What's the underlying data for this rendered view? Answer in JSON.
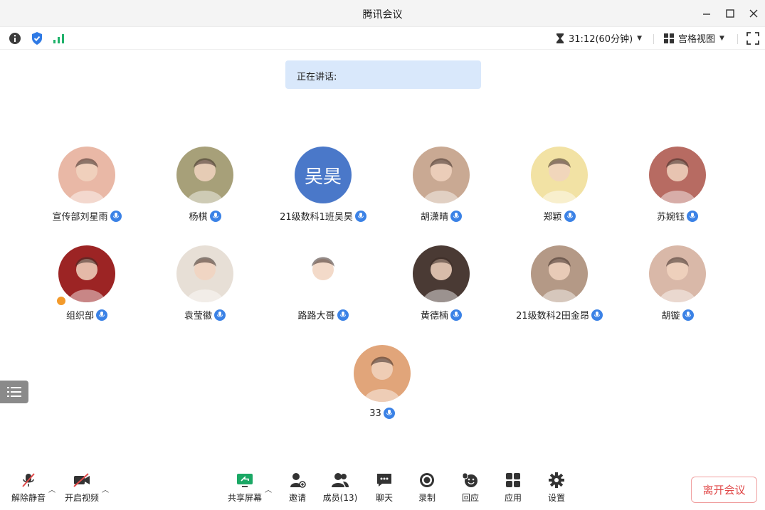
{
  "window": {
    "title": "腾讯会议"
  },
  "infobar": {
    "timer_text": "31:12(60分钟)",
    "view_label": "宫格视图"
  },
  "speaking": {
    "label": "正在讲话:"
  },
  "participants": [
    {
      "name": "宣传部刘星雨",
      "avatar": "photo",
      "color": "#e9b8a6"
    },
    {
      "name": "杨棋",
      "avatar": "photo",
      "color": "#a7a079"
    },
    {
      "name": "21级数科1班吴昊",
      "avatar": "text",
      "avatar_text": "吴昊"
    },
    {
      "name": "胡潇晴",
      "avatar": "photo",
      "color": "#c9a993"
    },
    {
      "name": "郑颖",
      "avatar": "photo",
      "color": "#f2e2a4"
    },
    {
      "name": "苏婉钰",
      "avatar": "photo",
      "color": "#b76b62"
    },
    {
      "name": "组织部",
      "avatar": "photo",
      "color": "#9c2424",
      "host": true
    },
    {
      "name": "袁莹徽",
      "avatar": "photo",
      "color": "#e7dfd6"
    },
    {
      "name": "路路大哥",
      "avatar": "photo",
      "color": "#ffffff"
    },
    {
      "name": "黄德楠",
      "avatar": "photo",
      "color": "#4a3a34"
    },
    {
      "name": "21级数科2田金昂",
      "avatar": "photo",
      "color": "#b49986"
    },
    {
      "name": "胡镟",
      "avatar": "photo",
      "color": "#d9b8a8"
    },
    {
      "name": "33",
      "avatar": "photo",
      "color": "#e1a57a"
    }
  ],
  "toolbar": {
    "unmute": "解除静音",
    "start_video": "开启视频",
    "share_screen": "共享屏幕",
    "invite": "邀请",
    "members": "成员(13)",
    "chat": "聊天",
    "record": "录制",
    "react": "回应",
    "apps": "应用",
    "settings": "设置",
    "leave": "离开会议"
  },
  "colors": {
    "accent": "#3b82e6",
    "leave": "#e04848",
    "speaking_bg": "#d9e8fb",
    "signal": "#20b26b"
  }
}
